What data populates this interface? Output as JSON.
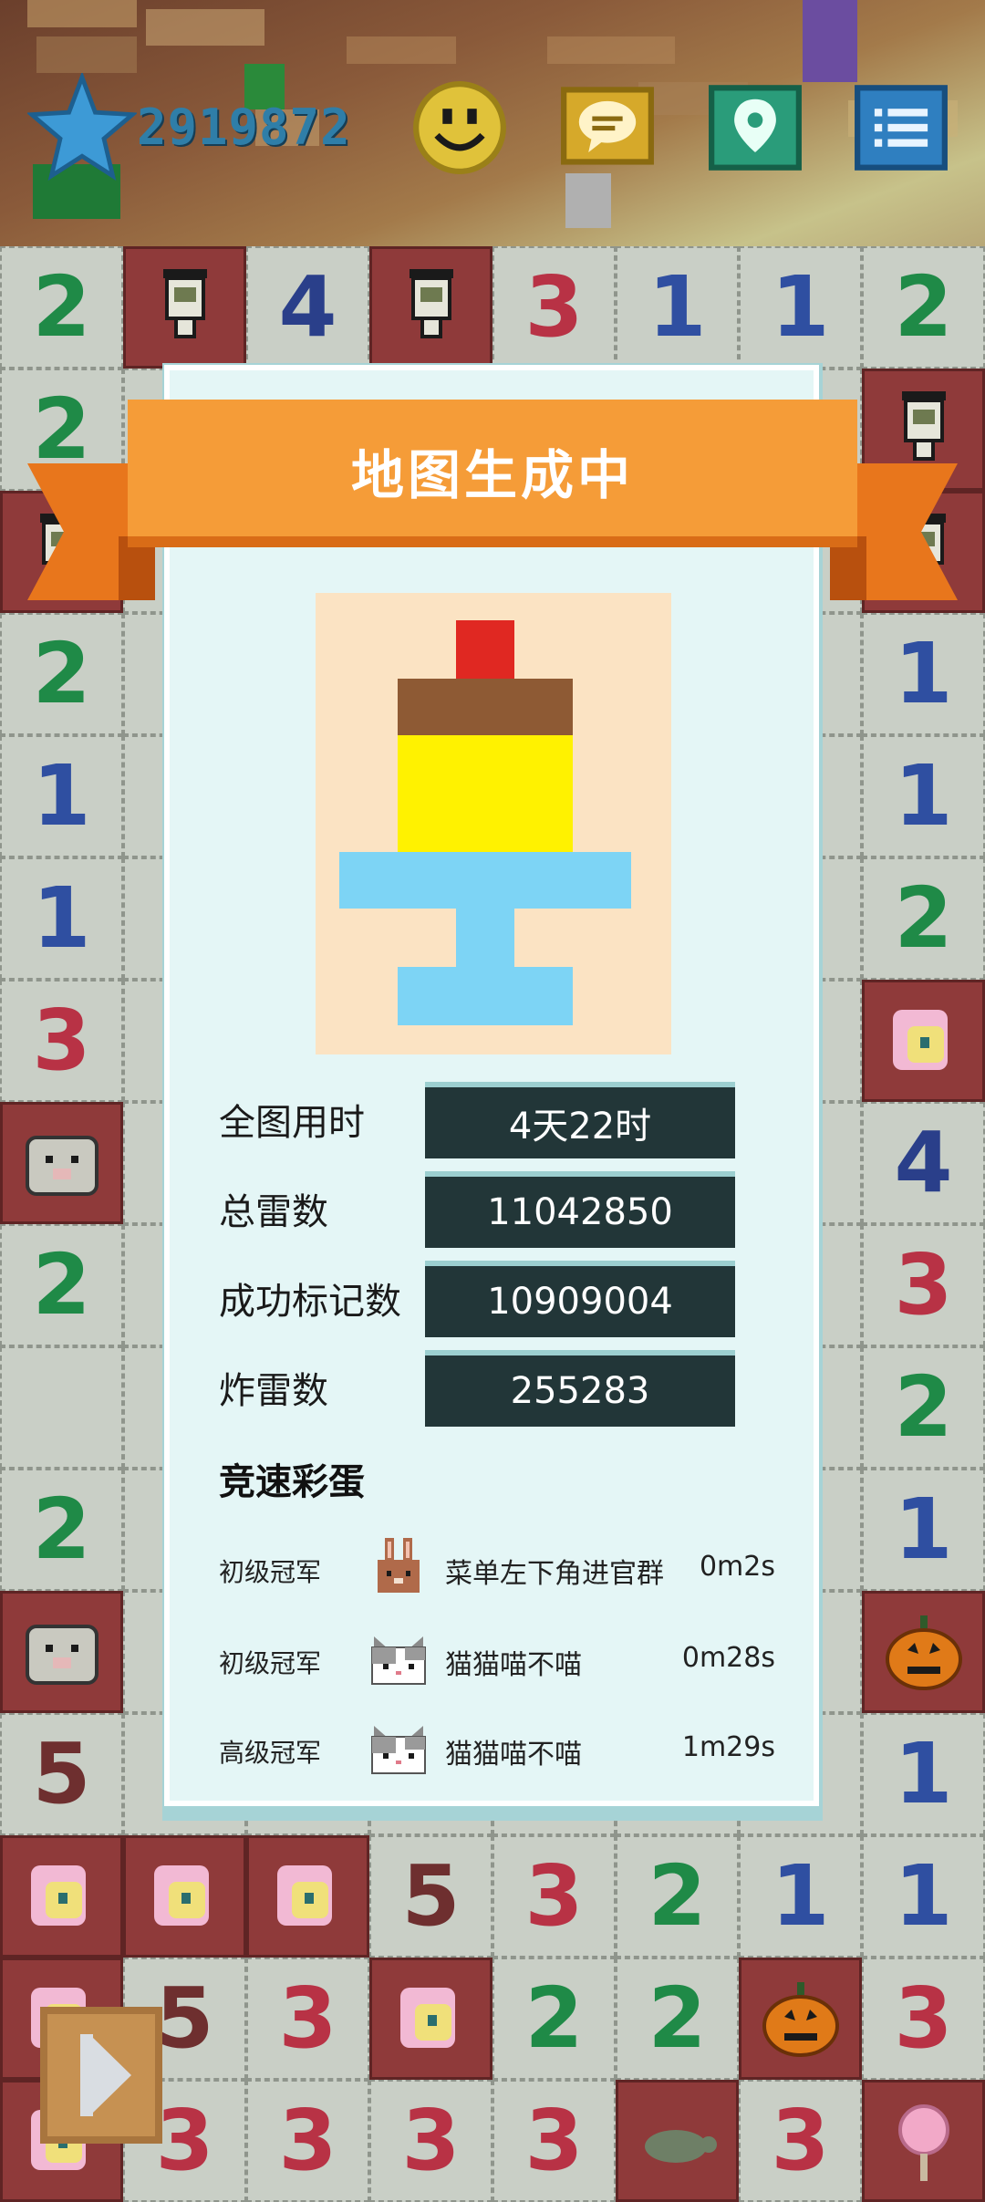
{
  "header": {
    "score": "2919872",
    "icons": [
      "star-icon",
      "smiley-icon",
      "chat-icon",
      "map-pin-icon",
      "menu-icon"
    ]
  },
  "board": {
    "visible_tiles": [
      [
        "2",
        "flag",
        "4",
        "flag",
        "3",
        "1",
        "1",
        "2"
      ],
      [
        "2",
        "",
        "",
        "",
        "",
        "",
        "",
        "flag"
      ],
      [
        "flag",
        "",
        "",
        "",
        "",
        "",
        "",
        "flag"
      ],
      [
        "2",
        "",
        "",
        "",
        "",
        "",
        "",
        "1"
      ],
      [
        "1",
        "",
        "",
        "",
        "",
        "",
        "",
        "1"
      ],
      [
        "1",
        "",
        "",
        "",
        "",
        "",
        "",
        "2"
      ],
      [
        "3",
        "",
        "",
        "",
        "",
        "",
        "",
        "pony"
      ],
      [
        "pig",
        "",
        "",
        "",
        "",
        "",
        "",
        "4"
      ],
      [
        "2",
        "",
        "",
        "",
        "",
        "",
        "",
        "3"
      ],
      [
        "",
        "",
        "",
        "",
        "",
        "",
        "",
        "2"
      ],
      [
        "2",
        "",
        "",
        "",
        "",
        "",
        "",
        "1"
      ],
      [
        "pig",
        "",
        "",
        "",
        "",
        "",
        "",
        "pumpkin"
      ],
      [
        "5",
        "",
        "",
        "",
        "",
        "",
        "",
        "1"
      ],
      [
        "pony",
        "pony",
        "pony",
        "5",
        "3",
        "2",
        "1",
        "1"
      ],
      [
        "pony",
        "5",
        "3",
        "pony",
        "2",
        "2",
        "pumpkin",
        "3"
      ],
      [
        "pony",
        "3",
        "3",
        "3",
        "3",
        "turtle",
        "3",
        "lollipop"
      ]
    ]
  },
  "modal": {
    "title": "地图生成中",
    "stats": [
      {
        "label": "全图用时",
        "value": "4天22时"
      },
      {
        "label": "总雷数",
        "value": "11042850"
      },
      {
        "label": "成功标记数",
        "value": "10909004"
      },
      {
        "label": "炸雷数",
        "value": "255283"
      }
    ],
    "easter_title": "竞速彩蛋",
    "records": [
      {
        "rank": "初级冠军",
        "avatar": "rabbit-avatar-icon",
        "player": "菜单左下角进官群",
        "time": "0m2s"
      },
      {
        "rank": "初级冠军",
        "avatar": "cat-avatar-icon",
        "player": "猫猫喵不喵",
        "time": "0m28s"
      },
      {
        "rank": "高级冠军",
        "avatar": "cat-avatar-icon",
        "player": "猫猫喵不喵",
        "time": "1m29s"
      }
    ]
  },
  "footer": {
    "play_icon": "play-icon"
  }
}
